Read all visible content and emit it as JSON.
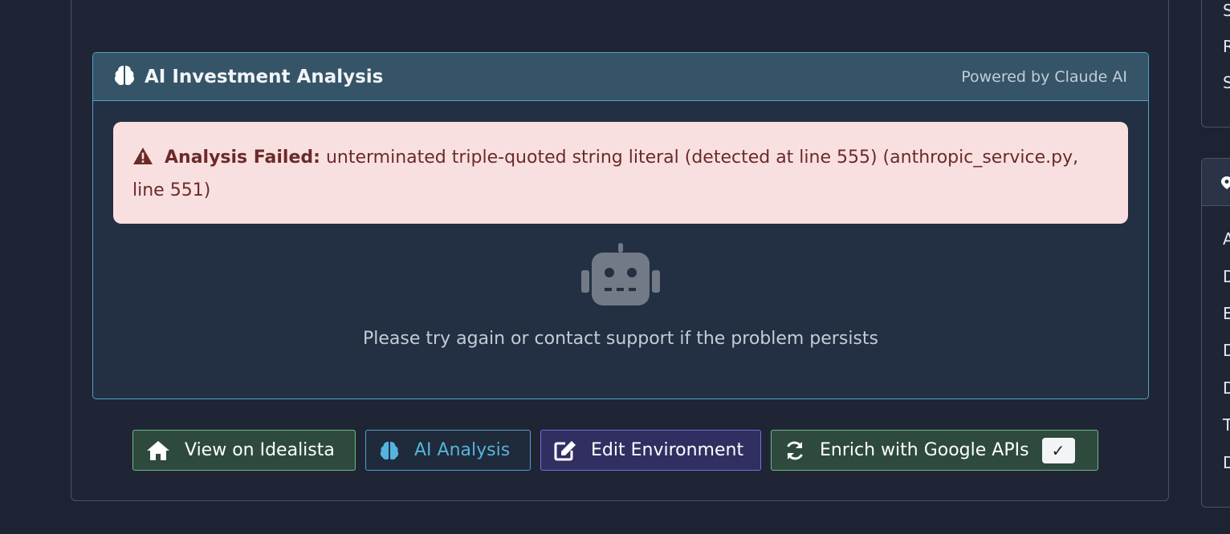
{
  "ai_panel": {
    "icon": "brain-icon",
    "title": "AI Investment Analysis",
    "powered_by": "Powered by Claude AI",
    "alert": {
      "icon": "warning-icon",
      "label": "Analysis Failed:",
      "message": "unterminated triple-quoted string literal (detected at line 555) (anthropic_service.py, line 551)"
    },
    "robot_icon": "robot-icon",
    "retry_text": "Please try again or contact support if the problem persists"
  },
  "actions": {
    "idealista": {
      "icon": "home-icon",
      "label": "View on Idealista"
    },
    "ai_analysis": {
      "icon": "brain-icon",
      "label": "AI Analysis"
    },
    "edit_env": {
      "icon": "edit-icon",
      "label": "Edit Environment"
    },
    "enrich": {
      "icon": "refresh-icon",
      "label": "Enrich with Google APIs",
      "badge": "✓"
    }
  },
  "side_top": {
    "letters": [
      "S",
      "R",
      "S"
    ]
  },
  "side_bottom": {
    "header_icon": "map-pin-icon",
    "letters": [
      "A",
      "D",
      "E",
      "D",
      "D",
      "T",
      "D"
    ]
  },
  "colors": {
    "background": "#1e2333",
    "panel_border": "#4fa3c7",
    "alert_bg": "#f9e0e0",
    "alert_text": "#6b2a2a"
  }
}
